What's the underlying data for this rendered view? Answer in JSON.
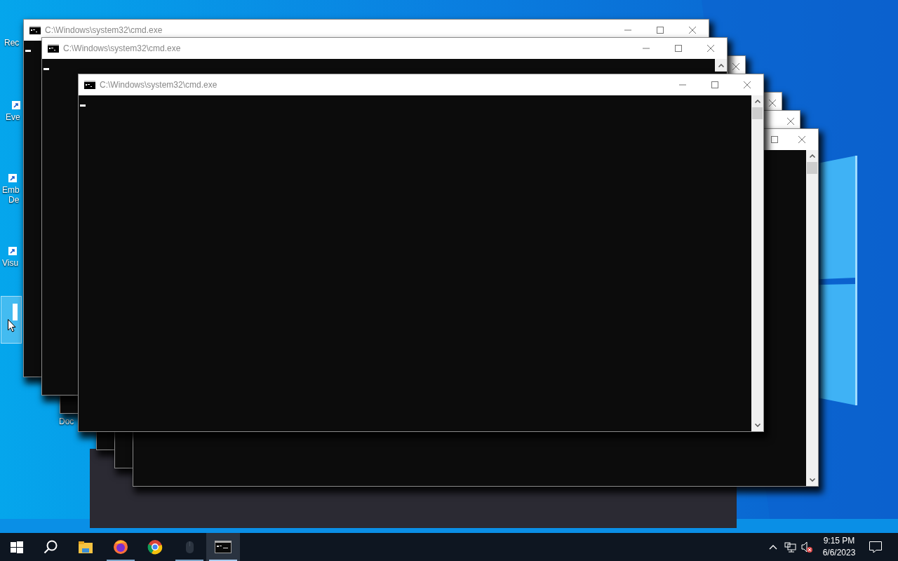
{
  "desktop": {
    "icons": [
      {
        "lines": [
          "Rec"
        ],
        "selected": false
      },
      {
        "lines": [
          "Eve"
        ],
        "selected": false
      },
      {
        "lines": [
          "Emb",
          "De"
        ],
        "selected": false
      },
      {
        "lines": [
          "Visu"
        ],
        "selected": false
      },
      {
        "selected": true
      },
      {
        "lines": [
          "Doc"
        ],
        "selected": false
      }
    ]
  },
  "windows": [
    {
      "buttons": [
        {
          "kind": "close"
        }
      ]
    },
    {
      "title": "C:\\Windows\\system32\\cmd.exe",
      "buttons": [
        {
          "kind": "minimize"
        },
        {
          "kind": "maximize"
        },
        {
          "kind": "close"
        }
      ]
    },
    {
      "title": "C:\\Windows\\system32\\cmd.exe",
      "buttons": [
        {
          "kind": "minimize"
        },
        {
          "kind": "maximize"
        },
        {
          "kind": "close"
        }
      ],
      "scrollbar": {
        "kind": "top"
      }
    },
    {
      "buttons": [
        {
          "kind": "close"
        }
      ]
    },
    {
      "buttons": [
        {
          "kind": "close"
        }
      ]
    },
    {
      "buttons": [
        {
          "kind": "maximize"
        },
        {
          "kind": "close"
        }
      ],
      "scrollbar": {
        "kind": "full"
      }
    },
    {
      "title": "C:\\Windows\\system32\\cmd.exe",
      "buttons": [
        {
          "kind": "minimize"
        },
        {
          "kind": "maximize"
        },
        {
          "kind": "close"
        }
      ],
      "scrollbar": {
        "kind": "full"
      }
    }
  ],
  "taskbar": {
    "apps": [
      {
        "kind": "start"
      },
      {
        "kind": "search"
      },
      {
        "kind": "explorer",
        "running": false,
        "selected": false
      },
      {
        "kind": "firefox",
        "running": true,
        "selected": false
      },
      {
        "kind": "chrome",
        "running": false,
        "selected": false
      },
      {
        "kind": "mouse",
        "running": true,
        "selected": false
      },
      {
        "kind": "terminal",
        "running": true,
        "selected": true
      }
    ],
    "tray": {
      "volume_muted": true,
      "time": "9:15 PM",
      "date": "6/6/2023"
    }
  }
}
